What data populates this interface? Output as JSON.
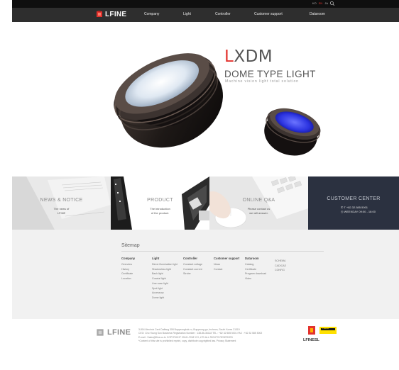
{
  "topbar": {
    "languages": [
      "KO",
      "EN",
      "JA"
    ],
    "active_language": "EN"
  },
  "brand": {
    "name": "LFINE",
    "accent": "#e3322d"
  },
  "nav": {
    "items": [
      "Company",
      "Light",
      "Controller",
      "Customer support",
      "Dataroom"
    ]
  },
  "hero": {
    "title_first": "L",
    "title_rest": "XDM",
    "subtitle": "DOME TYPE LIGHT",
    "description": "Machine vision light total solution"
  },
  "tiles": [
    {
      "title": "NEWS & NOTICE",
      "desc": "The news of\nLFINE"
    },
    {
      "title": "PRODUCT",
      "desc": "The introduction\nof the product."
    },
    {
      "title": "ONLINE Q&A",
      "desc": "Please contact us\nwe will answer."
    },
    {
      "title": "CUSTOMER CENTER",
      "phone": "T +82.32.585.5001",
      "hours": "WEEKDAY 09:00 - 18:00"
    }
  ],
  "sitemap": {
    "title": "Sitemap",
    "columns": [
      {
        "head": "Company",
        "links": [
          "Overview",
          "History",
          "Certificate",
          "Location"
        ]
      },
      {
        "head": "Light",
        "links": [
          "Direct illumination light",
          "Shadowless light",
          "Back light",
          "Coaxial light",
          "Line scan light",
          "Spot light",
          "Accessory",
          "Dome light"
        ]
      },
      {
        "head": "Controller",
        "links": [
          "Constant voltage",
          "Constant current",
          "Strobe"
        ]
      },
      {
        "head": "Customer support",
        "links": [
          "News",
          "Contact"
        ]
      },
      {
        "head": "Dataroom",
        "links": [
          "Catalog",
          "Certificate",
          "Program download",
          "Video"
        ]
      },
      {
        "head": "",
        "links": [
          "SCHEMA",
          "CAD/CAE",
          "CONFIG"
        ]
      }
    ]
  },
  "footer": {
    "logo": "LFINE",
    "lines": [
      "3-804 Mechnix Cent Daffang 308 Bupyeongbuk-ro, Bupyeong-gu, Incheon, South Korea 21319",
      "CEO: Cho Young Sun Business Registration Number : 138-86-36118 TEL : +82 32 585 5001 FAX : +82 32 585 5002",
      "E-mail : Sales@lfine.co.kr COPYRIGHT 2016 LFINE CO.,LTD ALL RIGHTS RESERVED",
      "*Content of this site is prohibited reprint, copy, distribute copyrighted law. Privacy Statement"
    ],
    "partner_name": "LFINESL",
    "partner_badge": "TURCK"
  }
}
